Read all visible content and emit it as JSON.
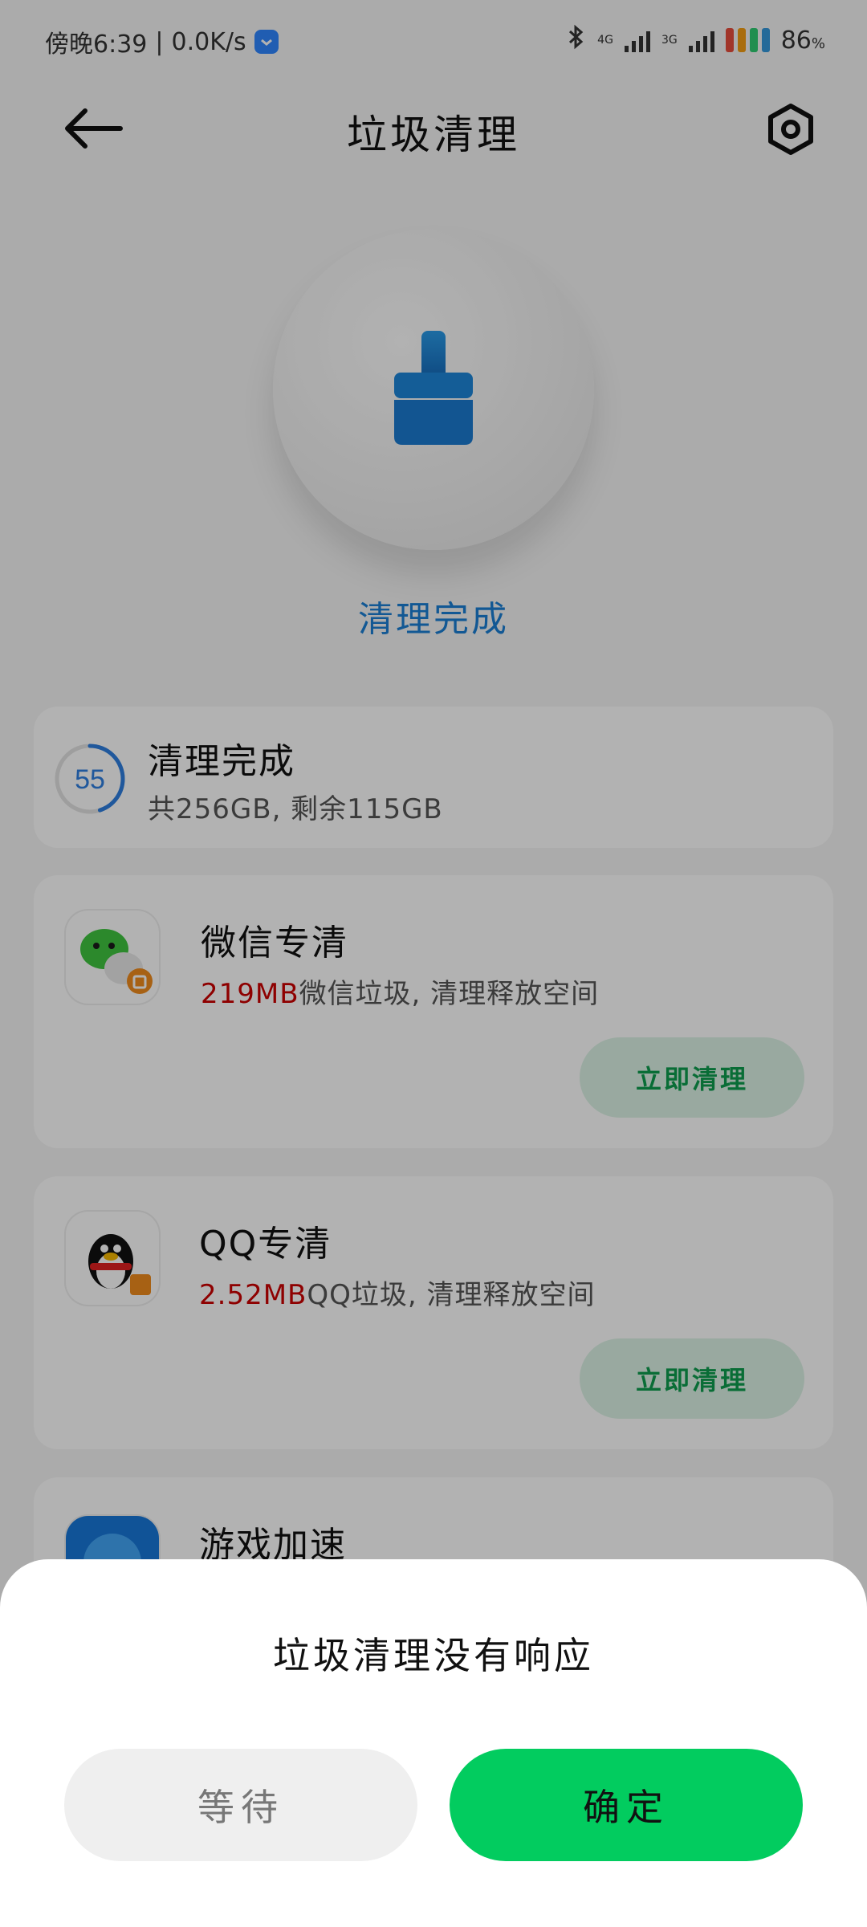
{
  "status_bar": {
    "time": "傍晚6:39",
    "separator": "|",
    "net_speed": "0.0K/s",
    "net_4g": "4G",
    "net_3g": "3G",
    "battery_percent": "86",
    "battery_unit": "%"
  },
  "header": {
    "title": "垃圾清理"
  },
  "hero": {
    "status": "清理完成"
  },
  "storage_card": {
    "gauge_value": "55",
    "gauge_fraction": 0.45,
    "title": "清理完成",
    "subtitle": "共256GB, 剩余115GB"
  },
  "wechat_card": {
    "title": "微信专清",
    "amount": "219MB",
    "desc": "微信垃圾, 清理释放空间",
    "button": "立即清理"
  },
  "qq_card": {
    "title": "QQ专清",
    "amount": "2.52MB",
    "desc": "QQ垃圾, 清理释放空间",
    "button": "立即清理"
  },
  "game_card": {
    "title": "游戏加速"
  },
  "dialog": {
    "title": "垃圾清理没有响应",
    "wait_button": "等待",
    "ok_button": "确定"
  },
  "colors": {
    "accent_blue": "#1a7fd4",
    "amount_red": "#cc0000",
    "confirm_green": "#02cc5f",
    "clean_button_text": "#0d9d4e"
  }
}
